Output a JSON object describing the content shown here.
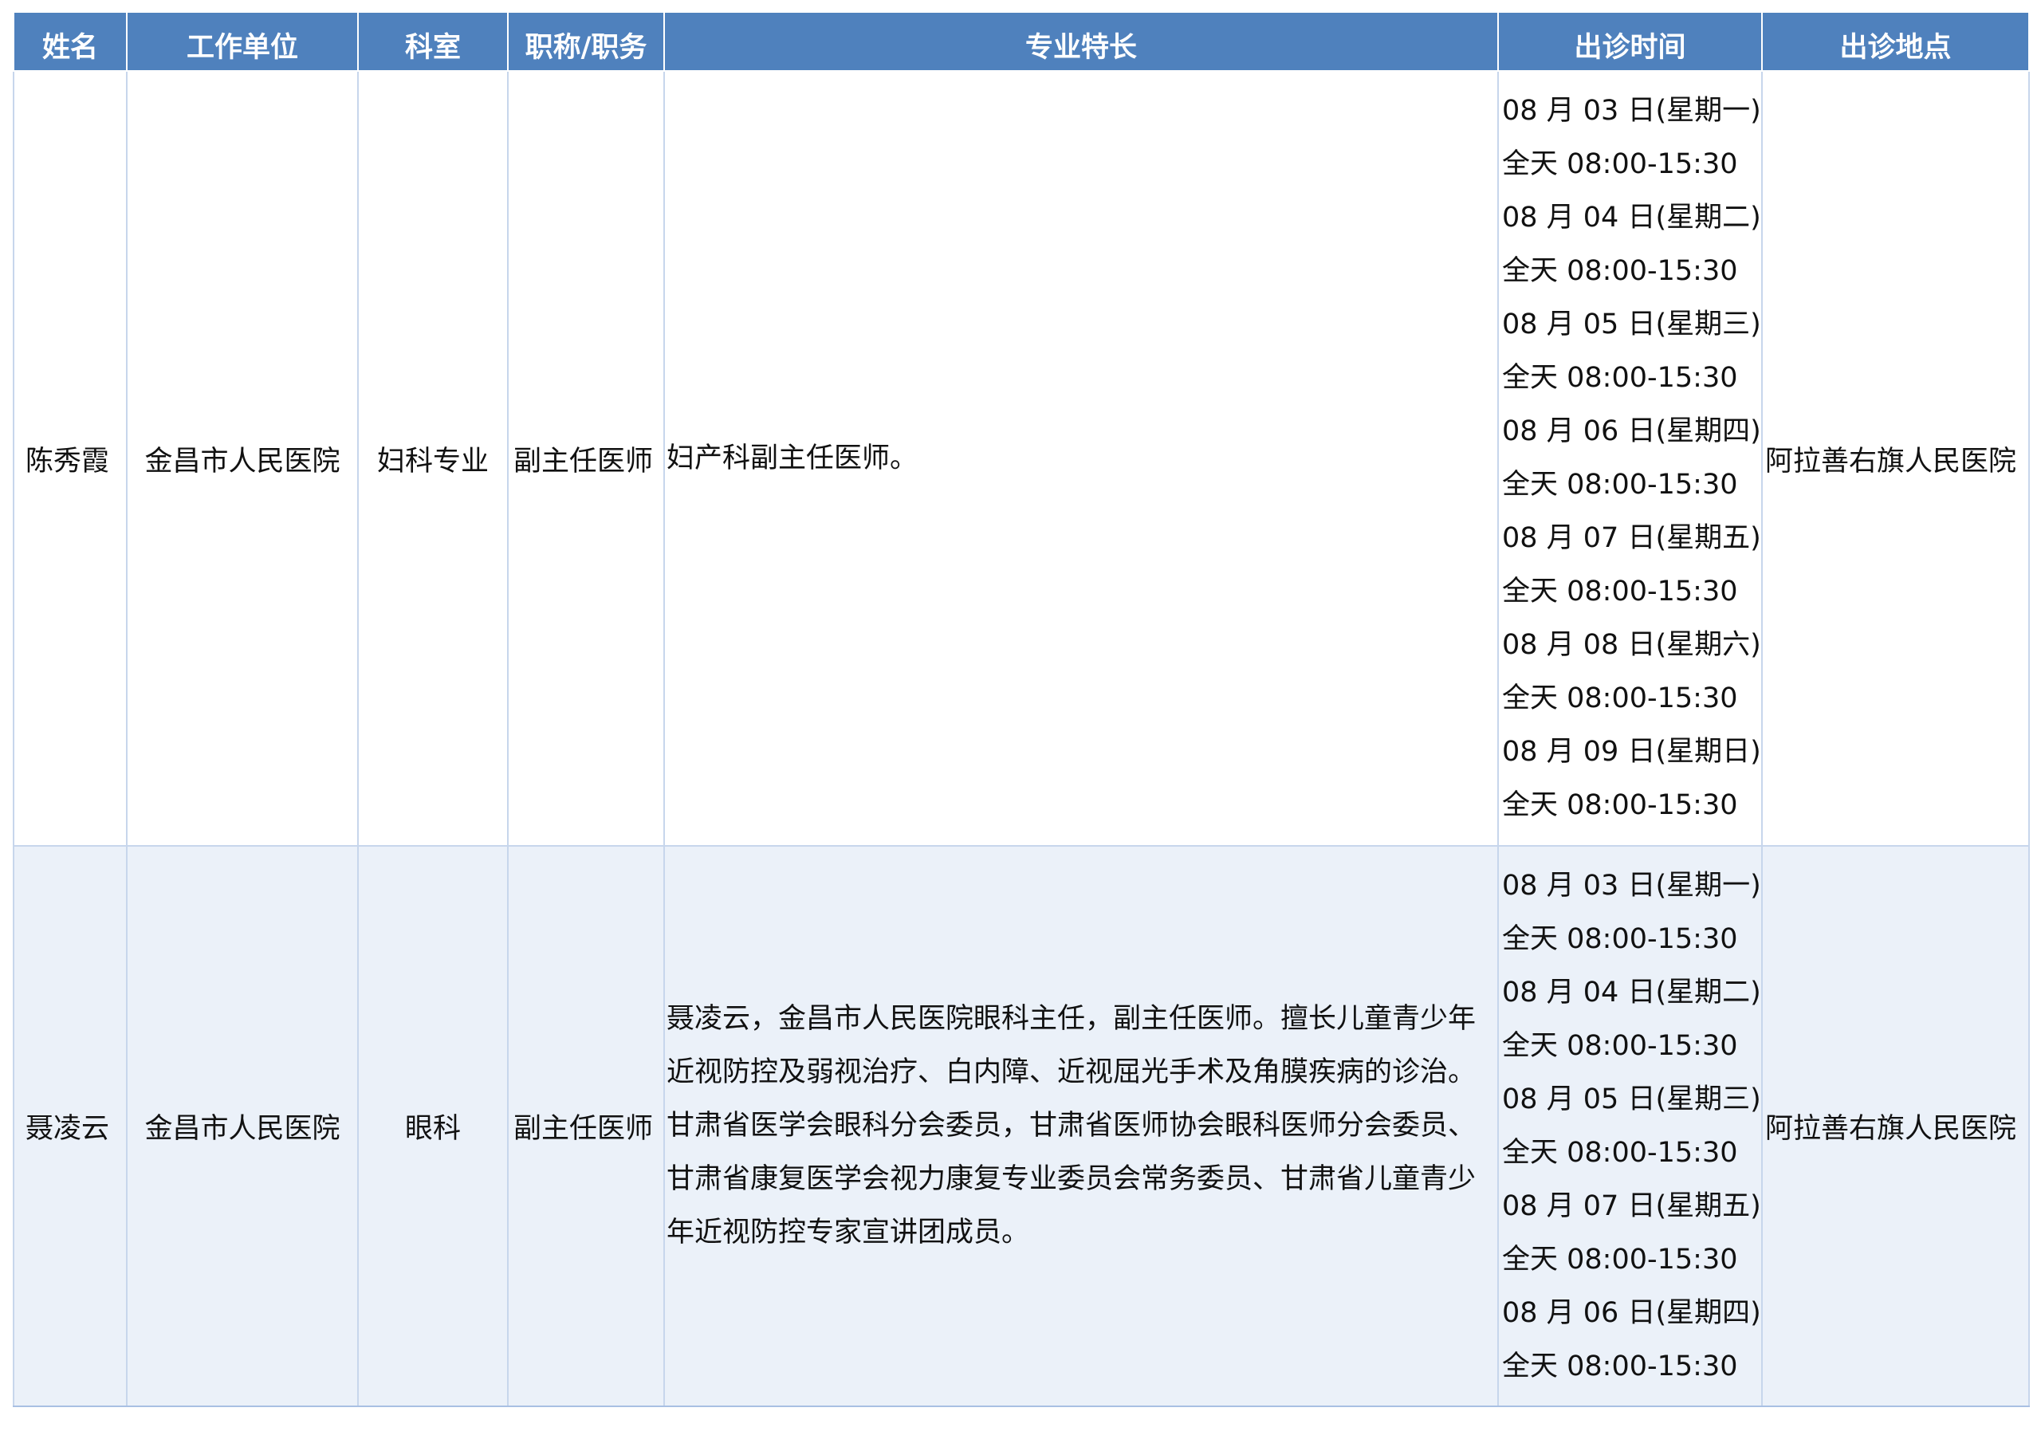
{
  "table": {
    "headers": {
      "name": "姓名",
      "unit": "工作单位",
      "dept": "科室",
      "title": "职称/职务",
      "specialty": "专业特长",
      "time": "出诊时间",
      "place": "出诊地点"
    },
    "colors": {
      "header_bg": "#4f81bd",
      "header_text": "#ffffff",
      "row_alt_bg": "#ebf1f9",
      "grid_line": "#c7d6ec"
    },
    "rows": [
      {
        "name": "陈秀霞",
        "unit": "金昌市人民医院",
        "dept": "妇科专业",
        "title": "副主任医师",
        "specialty": "妇产科副主任医师。",
        "time": [
          "08 月 03 日(星期一)",
          "全天 08:00-15:30",
          "08 月 04 日(星期二)",
          "全天 08:00-15:30",
          "08 月 05 日(星期三)",
          "全天 08:00-15:30",
          "08 月 06 日(星期四)",
          "全天 08:00-15:30",
          "08 月 07 日(星期五)",
          "全天 08:00-15:30",
          "08 月 08 日(星期六)",
          "全天 08:00-15:30",
          "08 月 09 日(星期日)",
          "全天 08:00-15:30"
        ],
        "place": "阿拉善右旗人民医院"
      },
      {
        "name": "聂凌云",
        "unit": "金昌市人民医院",
        "dept": "眼科",
        "title": "副主任医师",
        "specialty": "聂凌云，金昌市人民医院眼科主任，副主任医师。擅长儿童青少年近视防控及弱视治疗、白内障、近视屈光手术及角膜疾病的诊治。甘肃省医学会眼科分会委员，甘肃省医师协会眼科医师分会委员、甘肃省康复医学会视力康复专业委员会常务委员、甘肃省儿童青少年近视防控专家宣讲团成员。",
        "time": [
          "08 月 03 日(星期一)",
          "全天 08:00-15:30",
          "08 月 04 日(星期二)",
          "全天 08:00-15:30",
          "08 月 05 日(星期三)",
          "全天 08:00-15:30",
          "08 月 07 日(星期五)",
          "全天 08:00-15:30",
          "08 月 06 日(星期四)",
          "全天 08:00-15:30"
        ],
        "place": "阿拉善右旗人民医院"
      }
    ]
  }
}
